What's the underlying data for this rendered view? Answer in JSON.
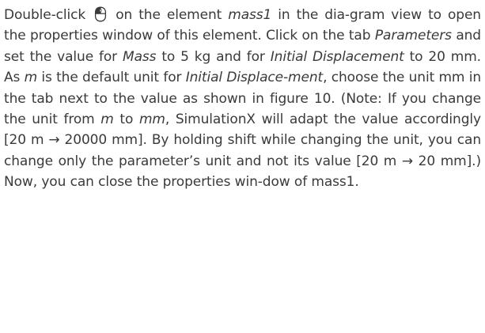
{
  "paragraph": {
    "s01": "Double-click ",
    "s02": " on the element ",
    "s03": "mass1",
    "s04": " in the dia-gram view to open the properties window of this element. Click on the tab ",
    "s05": "Parameters",
    "s06": " and set the value for ",
    "s07": "Mass",
    "s08": " to 5 kg and for ",
    "s09": "Initial Displacement",
    "s10": " to 20 mm. As ",
    "s11": "m",
    "s12": " is the default unit for ",
    "s13": "Initial Displace-ment",
    "s14": ", choose the unit mm in the tab next to the value as shown in figure 10. (Note: If you change the unit from ",
    "s15": "m",
    "s16": " to ",
    "s17": "mm",
    "s18": ", SimulationX will adapt the value accordingly [20 m → 20000 mm]. By holding shift while changing the unit, you can change only the parameter’s unit and not its value [20 m → 20 mm].) Now, you can close the properties win-dow of mass1."
  },
  "icons": {
    "mouse": "mouse-left-click-icon"
  }
}
